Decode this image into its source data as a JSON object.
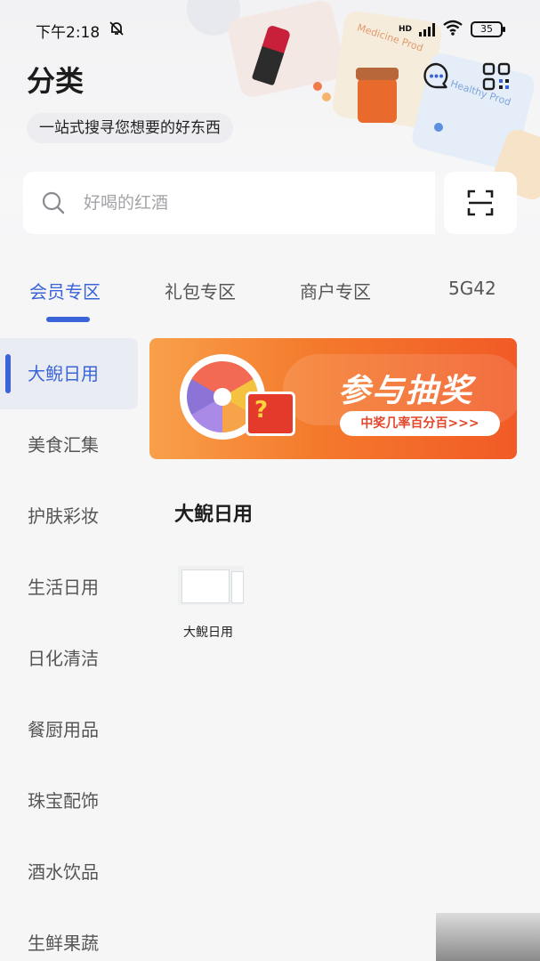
{
  "status_bar": {
    "time": "下午2:18",
    "signal_hd": "HD",
    "battery": "35"
  },
  "header": {
    "title": "分类",
    "slogan": "一站式搜寻您想要的好东西",
    "deco_text_1": "Medicine Prod",
    "deco_text_2": "Healthy Prod"
  },
  "search": {
    "placeholder": "好喝的红酒"
  },
  "tabs": [
    {
      "label": "会员专区",
      "active": true
    },
    {
      "label": "礼包专区",
      "active": false
    },
    {
      "label": "商户专区",
      "active": false
    },
    {
      "label": "5G42",
      "active": false
    }
  ],
  "sidebar": {
    "items": [
      {
        "label": "大鲵日用",
        "active": true
      },
      {
        "label": "美食汇集"
      },
      {
        "label": "护肤彩妆"
      },
      {
        "label": "生活日用"
      },
      {
        "label": "日化清洁"
      },
      {
        "label": "餐厨用品"
      },
      {
        "label": "珠宝配饰"
      },
      {
        "label": "酒水饮品"
      },
      {
        "label": "生鲜果蔬"
      }
    ]
  },
  "banner": {
    "title": "参与抽奖",
    "subtitle": "中奖几率百分百>>>"
  },
  "content": {
    "section_title": "大鲵日用",
    "products": [
      {
        "label": "大鲵日用"
      }
    ]
  },
  "colors": {
    "accent": "#3b64d8",
    "banner_orange": "#f25a26"
  }
}
